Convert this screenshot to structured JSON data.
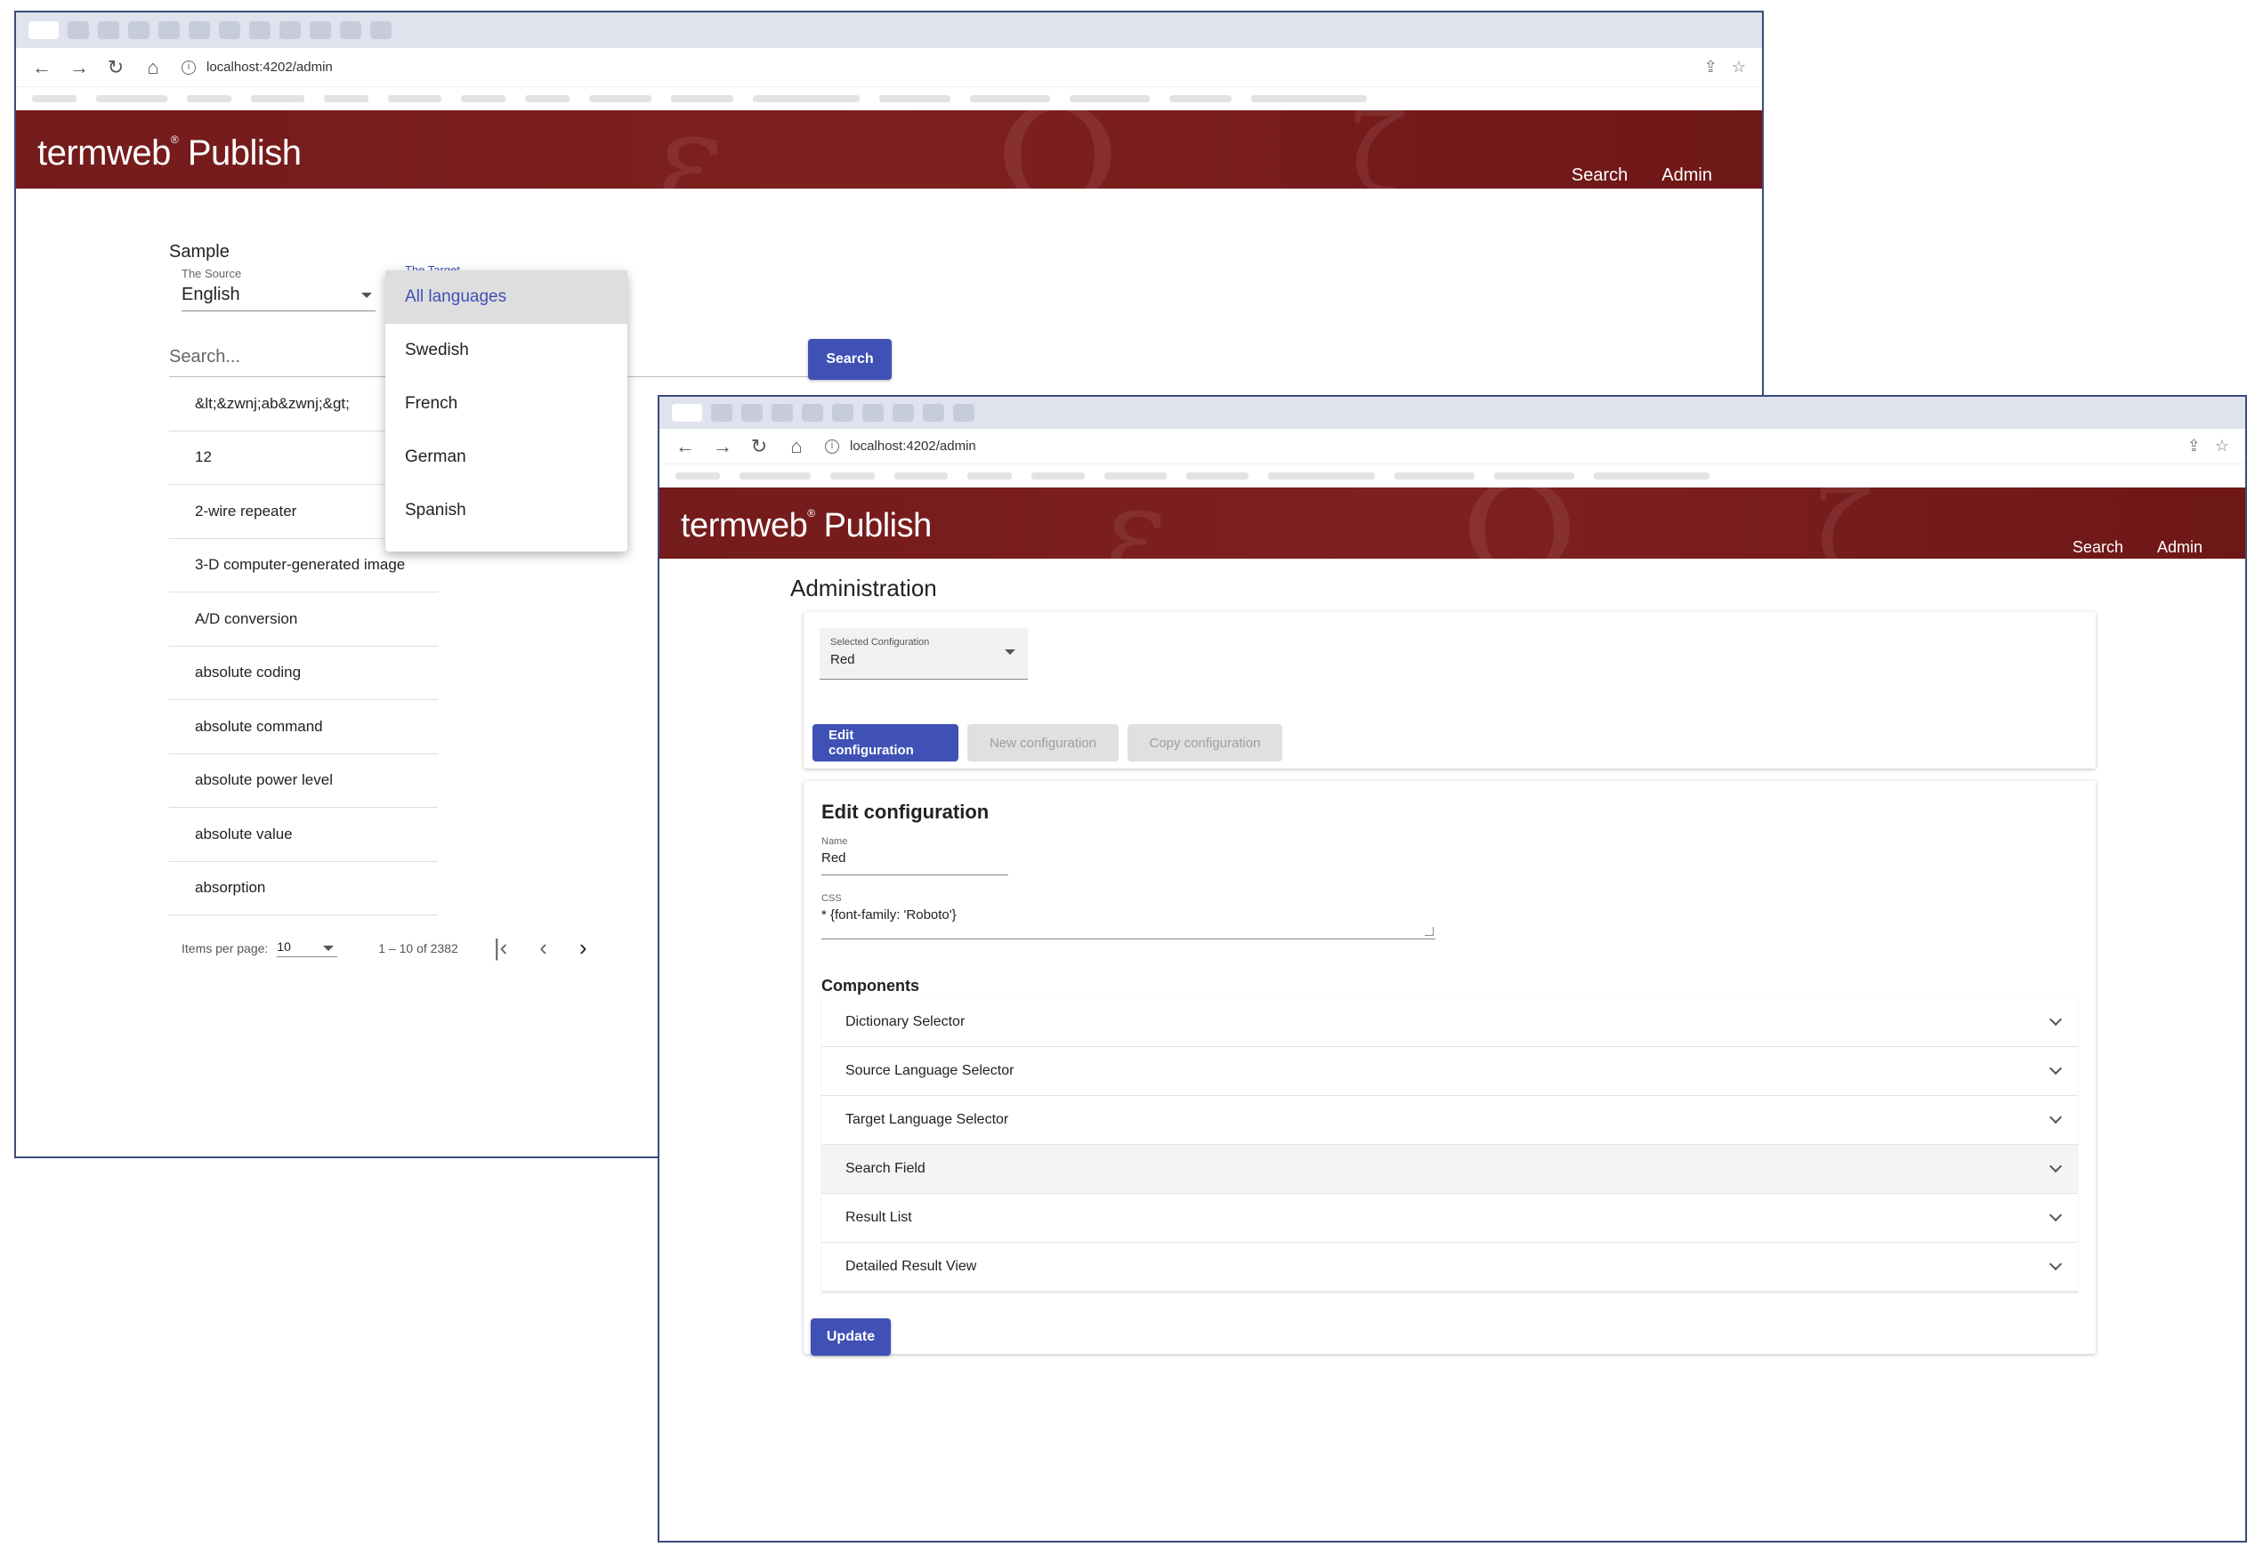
{
  "windowA": {
    "url": "localhost:4202/admin",
    "brand": "termweb",
    "brand_suffix": "Publish",
    "nav": {
      "search": "Search",
      "admin": "Admin"
    },
    "sample_title": "Sample",
    "source_label": "The Source",
    "source_value": "English",
    "target_label": "The Target",
    "search_placeholder": "Search...",
    "search_button": "Search",
    "results": [
      "&lt;&zwnj;ab&zwnj;&gt;",
      "12",
      "2-wire repeater",
      "3-D computer-generated image",
      "A/D conversion",
      "absolute coding",
      "absolute command",
      "absolute power level",
      "absolute value",
      "absorption"
    ],
    "pager": {
      "items_per_page_label": "Items per page:",
      "items_per_page": "10",
      "range": "1 – 10 of 2382"
    },
    "dropdown": {
      "options": [
        "All languages",
        "Swedish",
        "French",
        "German",
        "Spanish"
      ],
      "selected_index": 0
    }
  },
  "windowB": {
    "url": "localhost:4202/admin",
    "brand": "termweb",
    "brand_suffix": "Publish",
    "nav": {
      "search": "Search",
      "admin": "Admin"
    },
    "page_title": "Administration",
    "selected_configuration": {
      "label": "Selected Configuration",
      "value": "Red"
    },
    "buttons": {
      "edit": "Edit configuration",
      "new": "New configuration",
      "copy": "Copy configuration",
      "update": "Update"
    },
    "edit_section": {
      "title": "Edit configuration",
      "name_label": "Name",
      "name_value": "Red",
      "css_label": "CSS",
      "css_value": "* {font-family: 'Roboto'}"
    },
    "components_title": "Components",
    "components": [
      "Dictionary Selector",
      "Source Language Selector",
      "Target Language Selector",
      "Search Field",
      "Result List",
      "Detailed Result View"
    ]
  },
  "colors": {
    "banner": "#7a1d1d",
    "primary": "#3f51b5",
    "disabled": "#e0e0e0"
  }
}
